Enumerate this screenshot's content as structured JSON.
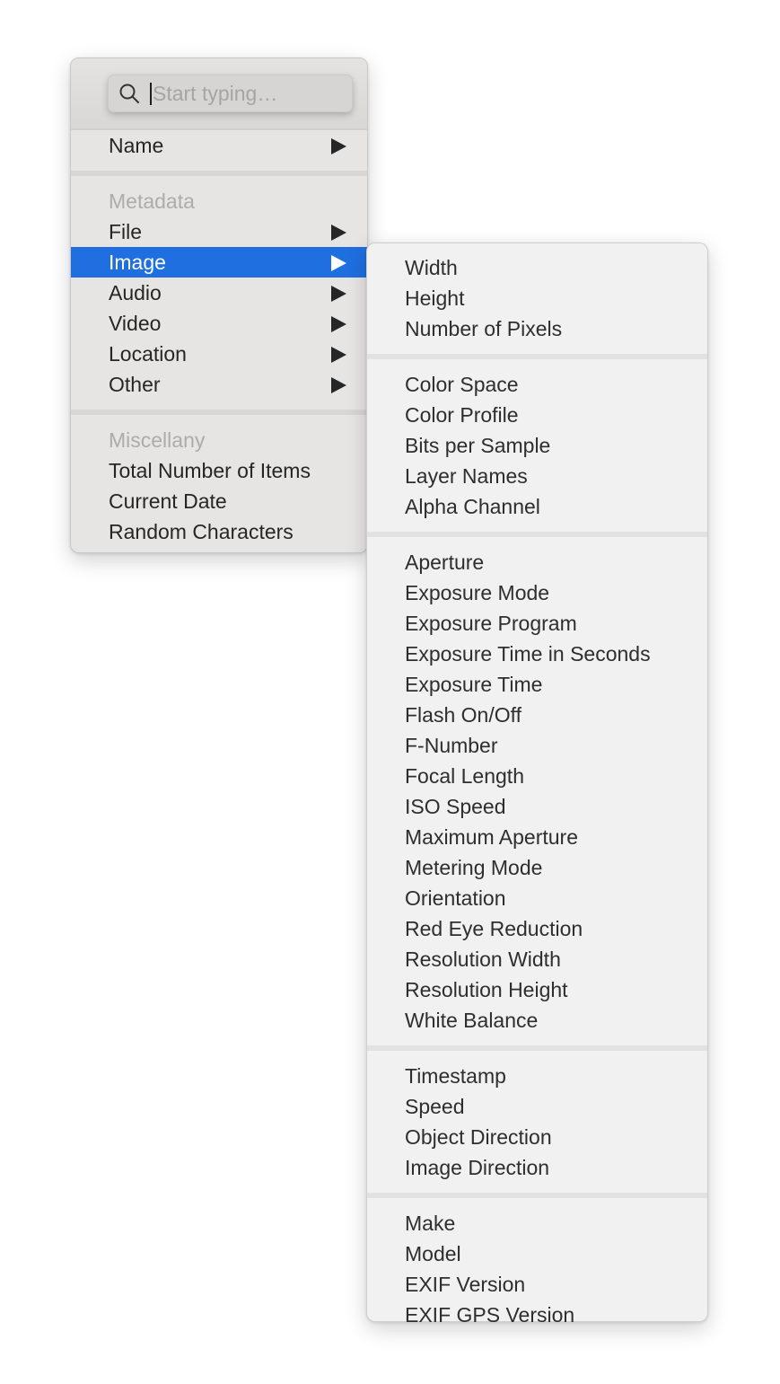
{
  "search": {
    "placeholder": "Start typing…",
    "value": ""
  },
  "main_menu": {
    "name_item": {
      "label": "Name",
      "has_submenu": true
    },
    "metadata_header": "Metadata",
    "metadata_items": [
      {
        "label": "File",
        "has_submenu": true,
        "selected": false
      },
      {
        "label": "Image",
        "has_submenu": true,
        "selected": true
      },
      {
        "label": "Audio",
        "has_submenu": true,
        "selected": false
      },
      {
        "label": "Video",
        "has_submenu": true,
        "selected": false
      },
      {
        "label": "Location",
        "has_submenu": true,
        "selected": false
      },
      {
        "label": "Other",
        "has_submenu": true,
        "selected": false
      }
    ],
    "misc_header": "Miscellany",
    "misc_items": [
      {
        "label": "Total Number of Items"
      },
      {
        "label": "Current Date"
      },
      {
        "label": "Random Characters"
      }
    ]
  },
  "image_submenu": {
    "groups": [
      [
        "Width",
        "Height",
        "Number of Pixels"
      ],
      [
        "Color Space",
        "Color Profile",
        "Bits per Sample",
        "Layer Names",
        "Alpha Channel"
      ],
      [
        "Aperture",
        "Exposure Mode",
        "Exposure Program",
        "Exposure Time in Seconds",
        "Exposure Time",
        "Flash On/Off",
        "F-Number",
        "Focal Length",
        "ISO Speed",
        "Maximum Aperture",
        "Metering Mode",
        "Orientation",
        "Red Eye Reduction",
        "Resolution Width",
        "Resolution Height",
        "White Balance"
      ],
      [
        "Timestamp",
        "Speed",
        "Object Direction",
        "Image Direction"
      ],
      [
        "Make",
        "Model",
        "EXIF Version",
        "EXIF GPS Version"
      ]
    ]
  },
  "colors": {
    "selection": "#1f6fe0",
    "menu_bg": "#e6e5e4",
    "submenu_bg": "#f1f1f1",
    "header_text": "#adacab"
  }
}
